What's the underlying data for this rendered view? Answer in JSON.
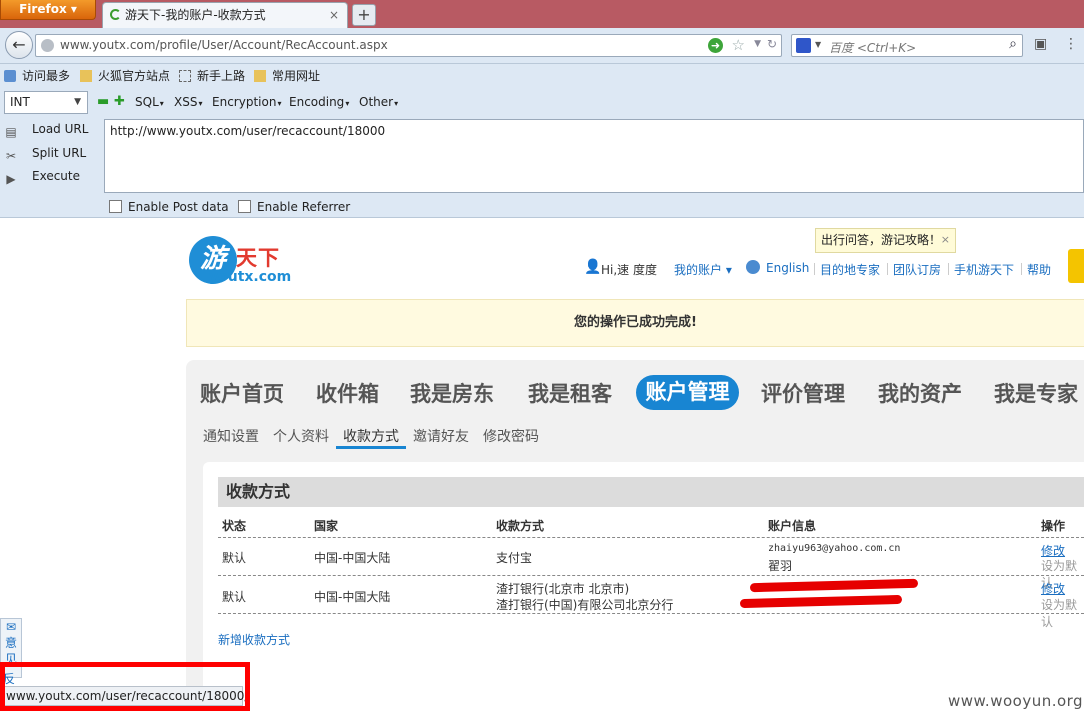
{
  "browser": {
    "app_button": "Firefox",
    "tab_title": "游天下-我的账户-收款方式",
    "tab_close": "×",
    "new_tab": "+",
    "url": "www.youtx.com/profile/User/Account/RecAccount.aspx",
    "search_placeholder": "百度 <Ctrl+K>",
    "bookmarks": [
      "访问最多",
      "火狐官方站点",
      "新手上路",
      "常用网址"
    ]
  },
  "hackbar": {
    "type_select": "INT",
    "menus": [
      "SQL",
      "XSS",
      "Encryption",
      "Encoding",
      "Other"
    ],
    "buttons": [
      "Load URL",
      "Split URL",
      "Execute"
    ],
    "url_value": "http://www.youtx.com/user/recaccount/18000",
    "enable_post": "Enable Post data",
    "enable_referrer": "Enable Referrer"
  },
  "site": {
    "logo_text": "游天下",
    "logo_domain": "youtx.com",
    "tip": "出行问答，游记攻略！",
    "tip_close": "×",
    "greeting": "Hi,速 度度",
    "topnav": [
      "我的账户",
      "English",
      "目的地专家",
      "团队订房",
      "手机游天下",
      "帮助"
    ],
    "notice": "您的操作已成功完成!",
    "main_tabs": [
      "账户首页",
      "收件箱",
      "我是房东",
      "我是租客",
      "账户管理",
      "评价管理",
      "我的资产",
      "我是专家"
    ],
    "sub_tabs": [
      "通知设置",
      "个人资料",
      "收款方式",
      "邀请好友",
      "修改密码"
    ],
    "section_title": "收款方式",
    "table_headers": [
      "状态",
      "国家",
      "收款方式",
      "账户信息",
      "操作"
    ],
    "rows": [
      {
        "status": "默认",
        "country": "中国-中国大陆",
        "method_line1": "支付宝",
        "method_line2": "",
        "account_line1": "zhaiyu963@yahoo.com.cn",
        "account_line2": "翟羽",
        "action_edit": "修改",
        "action_default": "设为默认"
      },
      {
        "status": "默认",
        "country": "中国-中国大陆",
        "method_line1": "渣打银行(北京市 北京市)",
        "method_line2": "渣打银行(中国)有限公司北京分行",
        "account_line1": "",
        "account_line2": "",
        "action_edit": "修改",
        "action_default": "设为默认"
      }
    ],
    "add_method": "新增收款方式",
    "side_widget": [
      "意",
      "见",
      "反"
    ]
  },
  "status_bar": "www.youtx.com/user/recaccount/18000/",
  "watermark": "www.wooyun.org",
  "colors": {
    "accent_blue": "#1885d2",
    "redaction": "#e60000",
    "title_bar": "#b85a63"
  }
}
